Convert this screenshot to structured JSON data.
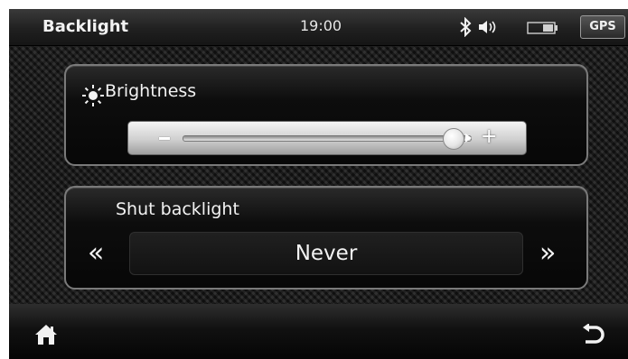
{
  "header": {
    "title": "Backlight",
    "time": "19:00",
    "gps_label": "GPS",
    "icons": [
      "bluetooth-icon",
      "volume-icon",
      "battery-icon"
    ]
  },
  "brightness": {
    "label": "Brightness",
    "icon": "sun-icon",
    "decrease_label": "−",
    "increase_label": "+",
    "level": 0.94
  },
  "shut_backlight": {
    "label": "Shut backlight",
    "value": "Never",
    "prev_label": "«",
    "next_label": "»"
  },
  "footer": {
    "icons": [
      "home-icon",
      "back-icon"
    ]
  },
  "colors": {
    "background": "#1a1a1a",
    "text": "#f2f2f2",
    "panel_border": "#7a7a7a"
  }
}
